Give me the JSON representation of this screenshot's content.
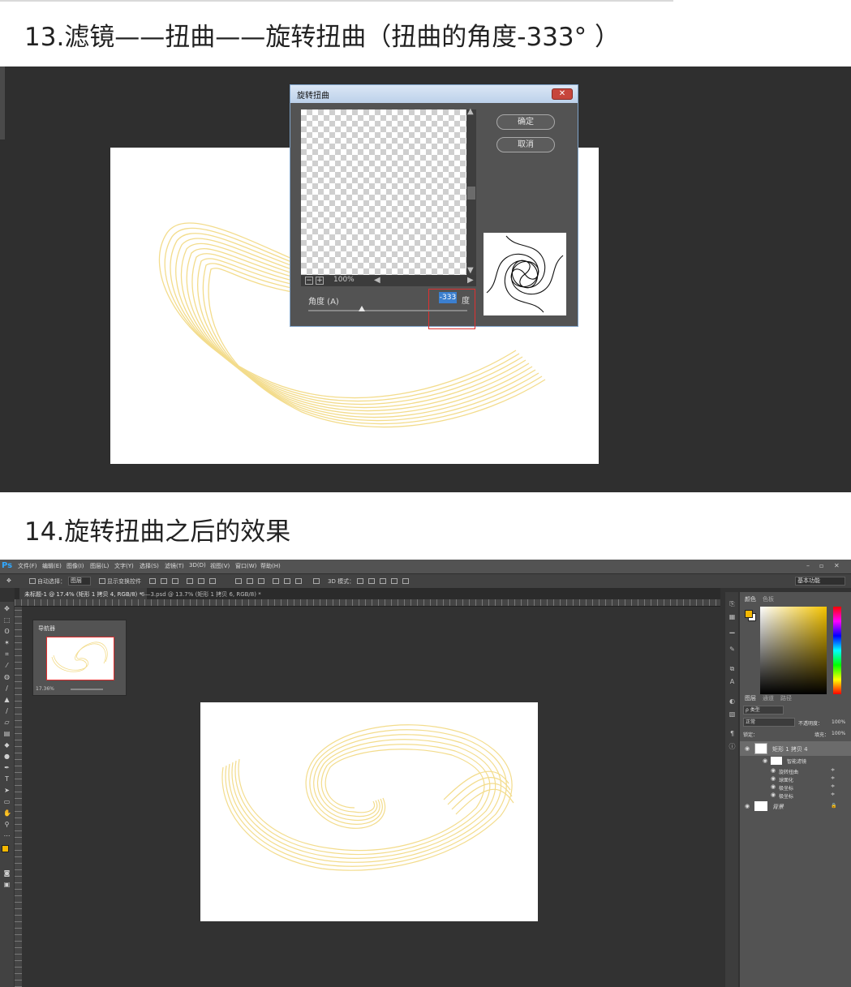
{
  "step13": {
    "heading": "13.滤镜——扭曲——旋转扭曲（扭曲的角度-333°  ）"
  },
  "dialog": {
    "title": "旋转扭曲",
    "close_label": "✕",
    "ok_label": "确定",
    "cancel_label": "取消",
    "zoom": "100%",
    "angle_label": "角度 (A)",
    "angle_value": "-333",
    "angle_unit": "度"
  },
  "step14": {
    "heading": "14.旋转扭曲之后的效果"
  },
  "ps": {
    "logo": "Ps",
    "menu": [
      "文件(F)",
      "编辑(E)",
      "图像(I)",
      "图层(L)",
      "文字(Y)",
      "选择(S)",
      "滤镜(T)",
      "3D(D)",
      "视图(V)",
      "窗口(W)",
      "帮助(H)"
    ],
    "window_controls": [
      "–",
      "▫",
      "✕"
    ],
    "options": {
      "auto_select": "自动选择：",
      "layer_dropdown": "图层",
      "show_transform": "显示变换控件",
      "mode3d": "3D 模式：",
      "workspace": "基本功能"
    },
    "tabs": [
      "未标题-1 @ 17.4% (矩形 1 拷贝 4, RGB/8) *",
      "6—3.psd @ 13.7% (矩形 1 拷贝 6, RGB/8) *"
    ],
    "navigator": {
      "title": "导航器",
      "zoom": "17.36%"
    },
    "color_tabs": [
      "颜色",
      "色板"
    ],
    "layer_tabs": [
      "图层",
      "通道",
      "路径"
    ],
    "layer_filter": "ρ 类型",
    "blend_mode": "正常",
    "opacity_label": "不透明度：",
    "opacity_value": "100%",
    "lock_label": "锁定：",
    "fill_label": "填充：",
    "fill_value": "100%",
    "layers": {
      "smart_layer": "矩形 1 拷贝 4",
      "smart_filters": "智能滤镜",
      "filters": [
        "旋转扭曲",
        "球面化",
        "极坐标",
        "极坐标"
      ],
      "background": "背景"
    }
  },
  "colors": {
    "swirl": "#f3dc8c",
    "fg_swatch": "#f5b800",
    "accent_red": "#e03030"
  }
}
